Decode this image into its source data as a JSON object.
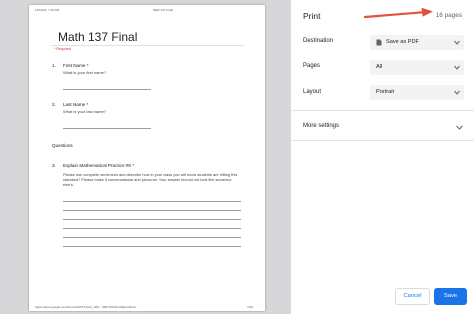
{
  "preview": {
    "header_left": "11/16/21, 7:16 AM",
    "header_center": "Math 137 Final",
    "footer_left": "https://docs.google.com/forms/d/1FTXmCk_JZ6-...30EYXtN1Fm3k/printform",
    "footer_right": "1/16",
    "form_title": "Math 137 Final",
    "required_note": "* Required",
    "q1": {
      "num": "1.",
      "label": "First Name *",
      "sub": "What is your first name?"
    },
    "q2": {
      "num": "2.",
      "label": "Last Name *",
      "sub": "What is your last name?"
    },
    "section": "Questions",
    "q3": {
      "num": "3.",
      "label": "Explain Mathematical Practice #6 *",
      "desc": "Please use complete sentences and describe how in your class you will know students are hitting this standard? Please make it conversational and personal. Your answer should not look like someone else's."
    }
  },
  "panel": {
    "title": "Print",
    "page_count": "16 pages",
    "destination": {
      "label": "Destination",
      "value": "Save as PDF",
      "icon": "document-icon"
    },
    "pages": {
      "label": "Pages",
      "value": "All"
    },
    "layout": {
      "label": "Layout",
      "value": "Portrait"
    },
    "more_settings": "More settings",
    "cancel": "Cancel",
    "save": "Save"
  },
  "colors": {
    "accent": "#1a73e8",
    "arrow": "#e0533a",
    "required": "#d93025"
  }
}
